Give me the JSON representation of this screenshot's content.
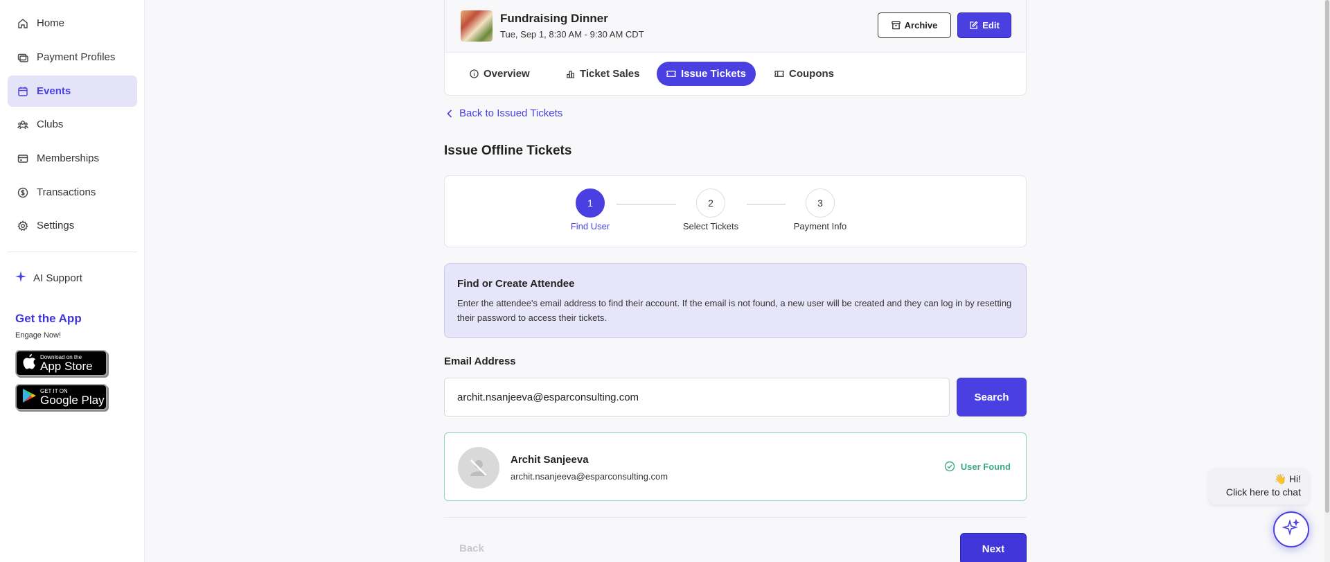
{
  "sidebar": {
    "items": [
      {
        "label": "Home",
        "icon": "home-icon"
      },
      {
        "label": "Payment Profiles",
        "icon": "payment-icon"
      },
      {
        "label": "Events",
        "icon": "calendar-icon"
      },
      {
        "label": "Clubs",
        "icon": "people-icon"
      },
      {
        "label": "Memberships",
        "icon": "card-icon"
      },
      {
        "label": "Transactions",
        "icon": "dollar-icon"
      },
      {
        "label": "Settings",
        "icon": "gear-icon"
      }
    ],
    "active_item": "Events",
    "ai_support": "AI Support",
    "get_app": "Get the App",
    "engage": "Engage Now!",
    "app_store": {
      "small": "Download on the",
      "large": "App Store"
    },
    "google_play": {
      "small": "GET IT ON",
      "large": "Google Play"
    }
  },
  "event": {
    "title": "Fundraising Dinner",
    "date": "Tue, Sep 1, 8:30 AM - 9:30 AM CDT",
    "archive_label": "Archive",
    "edit_label": "Edit"
  },
  "tabs": [
    {
      "label": "Overview",
      "icon": "info-icon"
    },
    {
      "label": "Ticket Sales",
      "icon": "bar-chart-icon"
    },
    {
      "label": "Issue Tickets",
      "icon": "ticket-icon"
    },
    {
      "label": "Coupons",
      "icon": "coupon-icon"
    }
  ],
  "active_tab": "Issue Tickets",
  "back_link": "Back to Issued Tickets",
  "page_title": "Issue Offline Tickets",
  "stepper": {
    "steps": [
      {
        "number": "1",
        "label": "Find User"
      },
      {
        "number": "2",
        "label": "Select Tickets"
      },
      {
        "number": "3",
        "label": "Payment Info"
      }
    ],
    "current_step": 1
  },
  "info": {
    "title": "Find or Create Attendee",
    "text": "Enter the attendee's email address to find their account. If the email is not found, a new user will be created and they can log in by resetting their password to access their tickets."
  },
  "email_form": {
    "label": "Email Address",
    "value": "archit.nsanjeeva@esparconsulting.com",
    "search_label": "Search"
  },
  "user_result": {
    "name": "Archit Sanjeeva",
    "email": "archit.nsanjeeva@esparconsulting.com",
    "status": "User Found"
  },
  "footer": {
    "back_label": "Back",
    "next_label": "Next"
  },
  "chat": {
    "greeting": "👋 Hi!",
    "prompt": "Click here to chat"
  },
  "colors": {
    "accent": "#4a3fe0",
    "success": "#3ea98a",
    "info_bg": "#e7e5f9"
  }
}
